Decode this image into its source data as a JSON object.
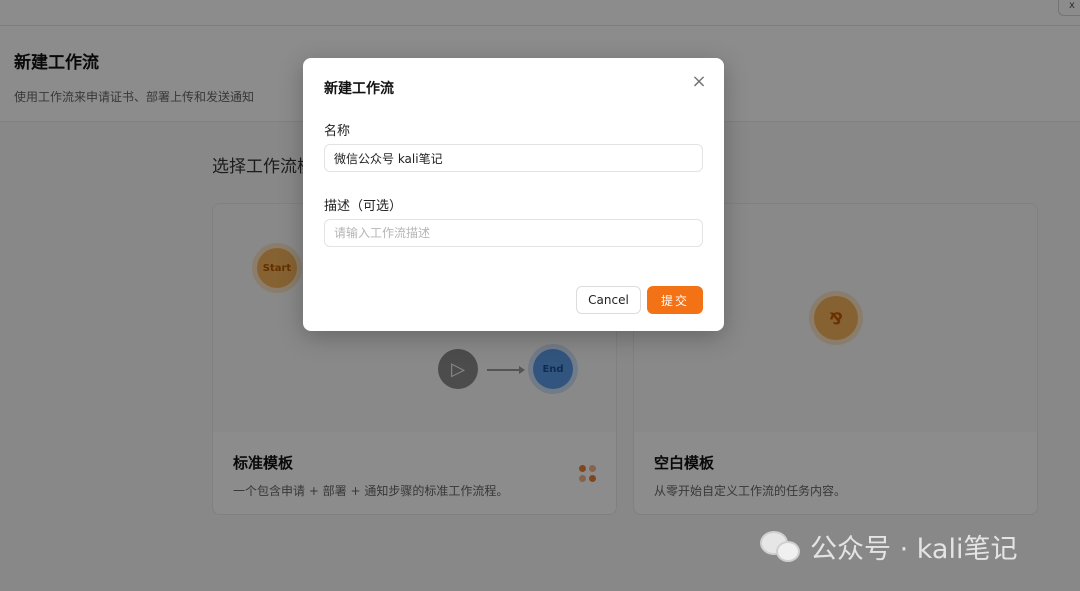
{
  "topbar": {
    "corner_label": "x"
  },
  "header": {
    "title": "新建工作流",
    "subtitle": "使用工作流来申请证书、部署上传和发送通知"
  },
  "section": {
    "title": "选择工作流模板"
  },
  "templates": [
    {
      "title": "标准模板",
      "description": "一个包含申请 + 部署 + 通知步骤的标准工作流程。",
      "nodes": {
        "start": "Start",
        "end": "End"
      }
    },
    {
      "title": "空白模板",
      "description": "从零开始自定义工作流的任务内容。"
    }
  ],
  "modal": {
    "title": "新建工作流",
    "close_glyph": "×",
    "name_label": "名称",
    "name_value": "微信公众号 kali笔记",
    "desc_label": "描述（可选）",
    "desc_placeholder": "请输入工作流描述",
    "cancel_label": "Cancel",
    "submit_label": "提交"
  },
  "watermark": {
    "text": "公众号 · kali笔记"
  },
  "colors": {
    "accent": "#f47216",
    "start_node": "#f5b25b",
    "end_node": "#5a9be6",
    "overlay": "rgba(0,0,0,0.45)"
  }
}
